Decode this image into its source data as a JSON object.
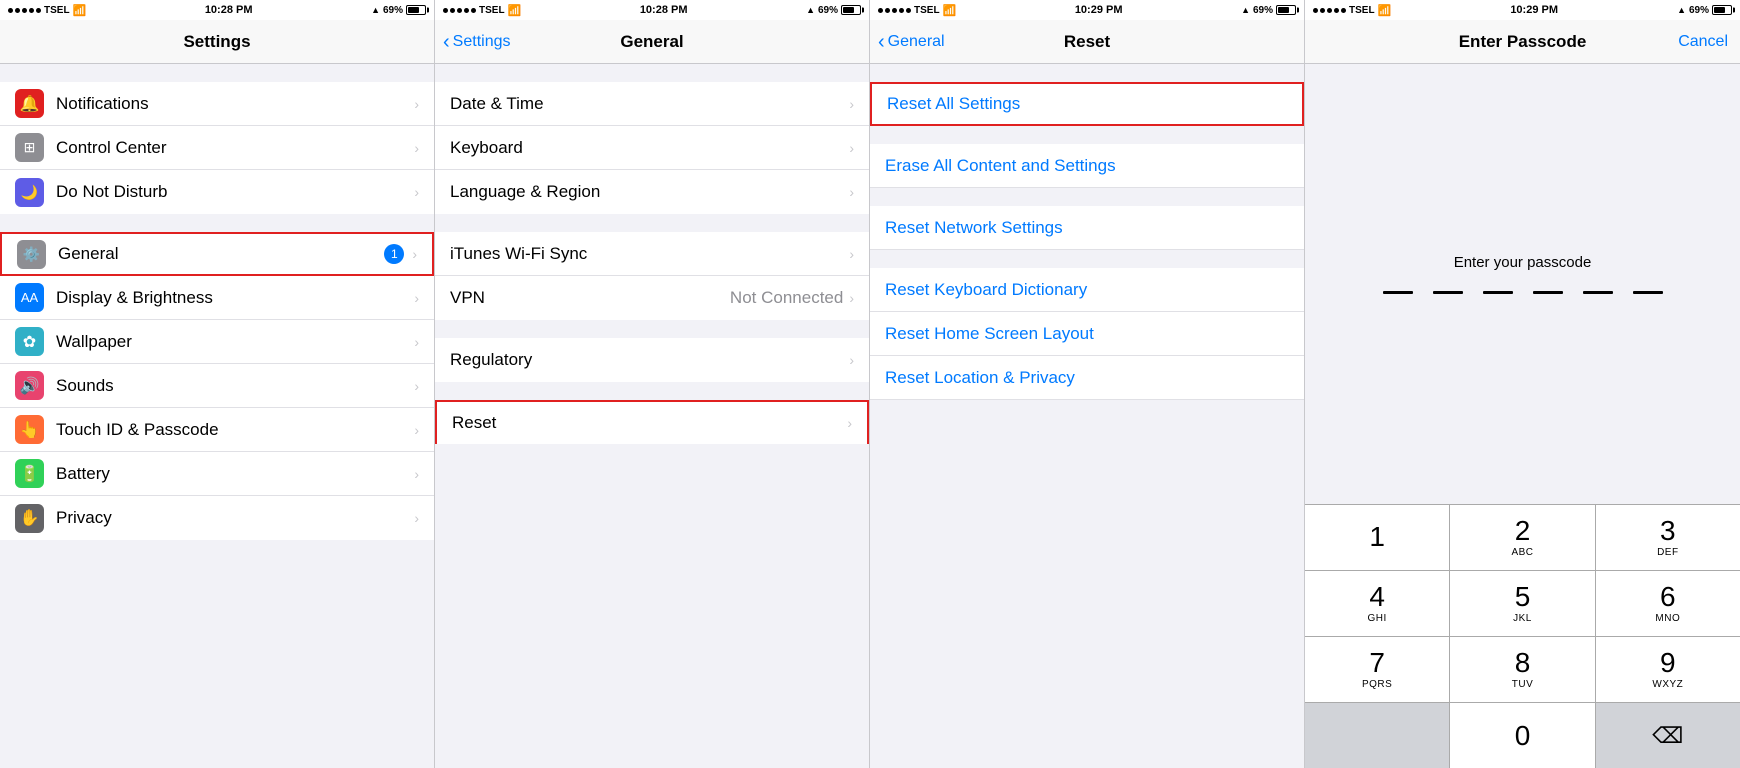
{
  "panels": [
    {
      "id": "settings",
      "statusBar": {
        "carrier": "●●●●● TSEL",
        "wifi": "WiFi",
        "time": "10:28 PM",
        "location": true,
        "battery": "69%"
      },
      "navTitle": "Settings",
      "navBack": null,
      "sections": [
        {
          "items": [
            {
              "icon": "notifications",
              "iconColor": "#e02020",
              "label": "Notifications",
              "value": "",
              "badge": null
            },
            {
              "icon": "control-center",
              "iconColor": "#8e8e93",
              "label": "Control Center",
              "value": "",
              "badge": null
            },
            {
              "icon": "do-not-disturb",
              "iconColor": "#5e5ce6",
              "label": "Do Not Disturb",
              "value": "",
              "badge": null
            }
          ]
        },
        {
          "items": [
            {
              "icon": "general",
              "iconColor": "#8e8e93",
              "label": "General",
              "value": "",
              "badge": "1",
              "highlighted": true
            },
            {
              "icon": "display",
              "iconColor": "#007aff",
              "label": "Display & Brightness",
              "value": "",
              "badge": null
            },
            {
              "icon": "wallpaper",
              "iconColor": "#30b0c7",
              "label": "Wallpaper",
              "value": "",
              "badge": null
            },
            {
              "icon": "sounds",
              "iconColor": "#e8436e",
              "label": "Sounds",
              "value": "",
              "badge": null
            },
            {
              "icon": "touchid",
              "iconColor": "#ff6b35",
              "label": "Touch ID & Passcode",
              "value": "",
              "badge": null
            },
            {
              "icon": "battery",
              "iconColor": "#30d158",
              "label": "Battery",
              "value": "",
              "badge": null
            },
            {
              "icon": "privacy",
              "iconColor": "#636366",
              "label": "Privacy",
              "value": "",
              "badge": null
            }
          ]
        }
      ]
    },
    {
      "id": "general",
      "statusBar": {
        "carrier": "●●●●● TSEL",
        "wifi": "WiFi",
        "time": "10:28 PM",
        "location": true,
        "battery": "69%"
      },
      "navTitle": "General",
      "navBack": "Settings",
      "sections": [
        {
          "items": [
            {
              "label": "Date & Time",
              "value": ""
            },
            {
              "label": "Keyboard",
              "value": ""
            },
            {
              "label": "Language & Region",
              "value": ""
            }
          ]
        },
        {
          "items": [
            {
              "label": "iTunes Wi-Fi Sync",
              "value": ""
            },
            {
              "label": "VPN",
              "value": "Not Connected"
            }
          ]
        },
        {
          "items": [
            {
              "label": "Regulatory",
              "value": ""
            }
          ]
        },
        {
          "items": [
            {
              "label": "Reset",
              "value": "",
              "highlighted": true
            }
          ]
        }
      ]
    },
    {
      "id": "reset",
      "statusBar": {
        "carrier": "●●●●● TSEL",
        "wifi": "WiFi",
        "time": "10:29 PM",
        "location": true,
        "battery": "69%"
      },
      "navTitle": "Reset",
      "navBack": "General",
      "items": [
        {
          "label": "Reset All Settings",
          "highlighted": true
        },
        {
          "label": "Erase All Content and Settings"
        },
        {
          "label": "Reset Network Settings"
        },
        {
          "label": "Reset Keyboard Dictionary"
        },
        {
          "label": "Reset Home Screen Layout"
        },
        {
          "label": "Reset Location & Privacy"
        }
      ]
    },
    {
      "id": "passcode",
      "statusBar": {
        "carrier": "●●●●● TSEL",
        "wifi": "WiFi",
        "time": "10:29 PM",
        "location": true,
        "battery": "69%"
      },
      "navTitle": "Enter Passcode",
      "navAction": "Cancel",
      "promptText": "Enter your passcode",
      "keypad": [
        {
          "number": "1",
          "letters": ""
        },
        {
          "number": "2",
          "letters": "ABC"
        },
        {
          "number": "3",
          "letters": "DEF"
        },
        {
          "number": "4",
          "letters": "GHI"
        },
        {
          "number": "5",
          "letters": "JKL"
        },
        {
          "number": "6",
          "letters": "MNO"
        },
        {
          "number": "7",
          "letters": "PQRS"
        },
        {
          "number": "8",
          "letters": "TUV"
        },
        {
          "number": "9",
          "letters": "WXYZ"
        },
        {
          "number": "0",
          "letters": ""
        }
      ]
    }
  ]
}
